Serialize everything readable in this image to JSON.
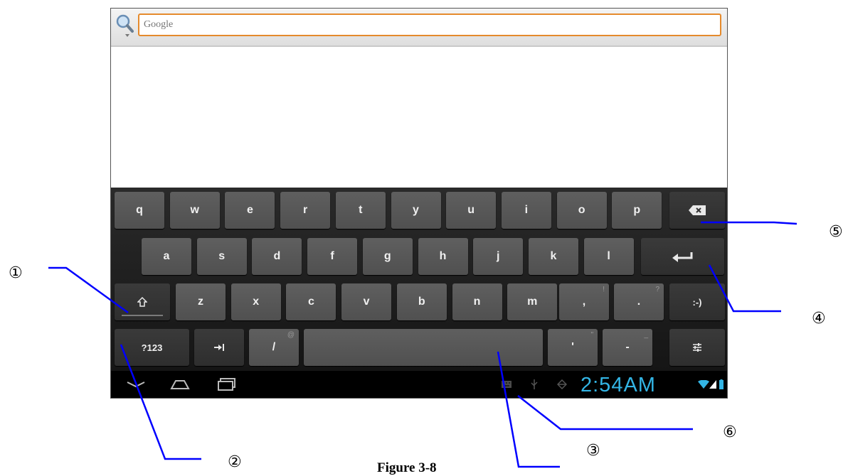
{
  "search": {
    "placeholder": "Google"
  },
  "keyboard": {
    "row1": [
      "q",
      "w",
      "e",
      "r",
      "t",
      "y",
      "u",
      "i",
      "o",
      "p"
    ],
    "row2": [
      "a",
      "s",
      "d",
      "f",
      "g",
      "h",
      "j",
      "k",
      "l"
    ],
    "row3": [
      "z",
      "x",
      "c",
      "v",
      "b",
      "n",
      "m"
    ],
    "comma": {
      "label": ",",
      "hint": "!"
    },
    "period": {
      "label": ".",
      "hint": "?"
    },
    "smiley": ":-)",
    "symbols": "?123",
    "slash": {
      "label": "/",
      "hint": "@"
    },
    "apostrophe": {
      "label": "'",
      "hint": "\""
    },
    "dash": {
      "label": "-",
      "hint": "_"
    }
  },
  "status": {
    "time": "2:54AM",
    "accent_color": "#33b5e5"
  },
  "callouts": {
    "c1": "①",
    "c2": "②",
    "c3": "③",
    "c4": "④",
    "c5": "⑤",
    "c6": "⑥"
  },
  "caption": "Figure 3-8"
}
